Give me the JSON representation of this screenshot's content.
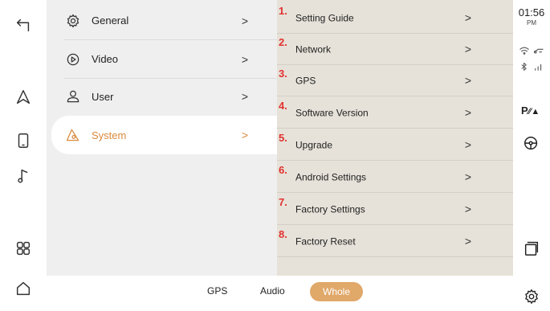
{
  "menu": {
    "items": [
      {
        "label": "General",
        "icon": "gear-icon"
      },
      {
        "label": "Video",
        "icon": "play-circle-icon"
      },
      {
        "label": "User",
        "icon": "user-icon"
      },
      {
        "label": "System",
        "icon": "system-warning-icon",
        "selected": true
      }
    ],
    "chevron": ">"
  },
  "detail": {
    "items": [
      {
        "num": "1.",
        "label": "Setting Guide"
      },
      {
        "num": "2.",
        "label": "Network"
      },
      {
        "num": "3.",
        "label": "GPS"
      },
      {
        "num": "4.",
        "label": "Software Version"
      },
      {
        "num": "5.",
        "label": "Upgrade"
      },
      {
        "num": "6.",
        "label": "Android Settings"
      },
      {
        "num": "7.",
        "label": "Factory Settings"
      },
      {
        "num": "8.",
        "label": "Factory Reset"
      }
    ],
    "chevron": ">"
  },
  "status": {
    "time": "01:56",
    "ampm": "PM",
    "parking_label": "P"
  },
  "bottom": {
    "tabs": [
      {
        "label": "GPS"
      },
      {
        "label": "Audio"
      },
      {
        "label": "Whole",
        "active": true
      }
    ]
  },
  "colors": {
    "accent": "#d98a3d",
    "active_tab_bg": "#e0a869",
    "number_red": "#e23030",
    "detail_bg": "#e6e2d9",
    "menu_bg": "#efefef"
  }
}
